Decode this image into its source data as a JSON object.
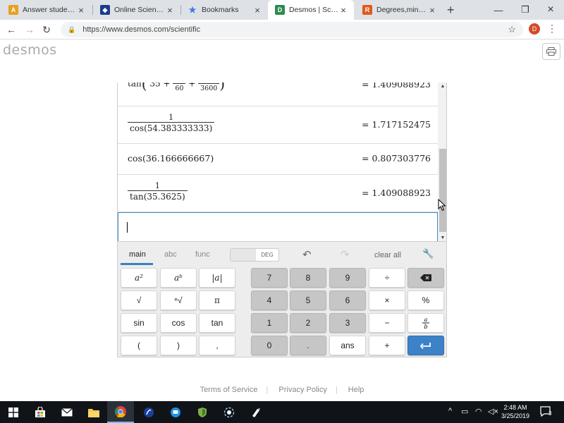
{
  "browser": {
    "tabs": [
      {
        "title": "Answer students' q",
        "icon": "A",
        "color": "#e8a020",
        "active": false
      },
      {
        "title": "Online Scientific C",
        "icon": "◆",
        "color": "#1a3c8c",
        "active": false
      },
      {
        "title": "Bookmarks",
        "icon": "★",
        "color": "#3b78e7",
        "active": false
      },
      {
        "title": "Desmos | Scientific",
        "icon": "D",
        "color": "#2d8a4e",
        "active": true
      },
      {
        "title": "Degrees,minutes,s",
        "icon": "R",
        "color": "#e05a1a",
        "active": false
      }
    ],
    "new_tab": "+",
    "url": "https://www.desmos.com/scientific",
    "profile_initial": "D"
  },
  "desmos": {
    "logo": "desmos",
    "expressions": [
      {
        "fn": "tan",
        "a": "35",
        "b_num": "22",
        "b_den": "60",
        "c_num": "15",
        "c_den": "3600",
        "result": "= 1.409088923"
      },
      {
        "num": "1",
        "den_fn": "cos",
        "den_arg": "54.383333333",
        "result": "= 1.717152475"
      },
      {
        "fn": "cos",
        "arg": "36.166666667",
        "result": "= 0.807303776"
      },
      {
        "num": "1",
        "den_fn": "tan",
        "den_arg": "35.3625",
        "result": "= 1.409088923"
      }
    ],
    "keypad": {
      "tabs": [
        "main",
        "abc",
        "func"
      ],
      "deg_label": "DEG",
      "clear_label": "clear all",
      "keys": {
        "a2": "a²",
        "ab": "aᵇ",
        "abs": "|a|",
        "sqrt": "√",
        "nthroot": "ⁿ√",
        "pi": "π",
        "sin": "sin",
        "cos": "cos",
        "tan": "tan",
        "lparen": "(",
        "rparen": ")",
        "comma": ",",
        "n7": "7",
        "n8": "8",
        "n9": "9",
        "div": "÷",
        "n4": "4",
        "n5": "5",
        "n6": "6",
        "mul": "×",
        "pct": "%",
        "n1": "1",
        "n2": "2",
        "n3": "3",
        "minus": "−",
        "n0": "0",
        "dot": ".",
        "ans": "ans",
        "plus": "+"
      }
    },
    "footer": {
      "terms": "Terms of Service",
      "privacy": "Privacy Policy",
      "help": "Help"
    }
  },
  "taskbar": {
    "time": "2:48 AM",
    "date": "3/25/2019",
    "notifications": "3"
  }
}
